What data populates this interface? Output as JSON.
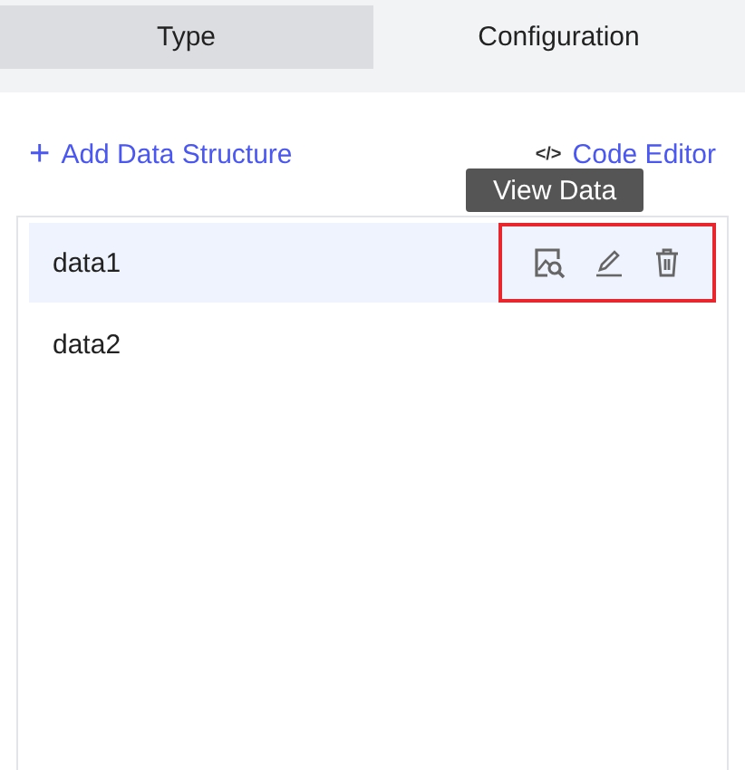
{
  "tabs": [
    {
      "label": "Type",
      "selected": true
    },
    {
      "label": "Configuration",
      "selected": false
    }
  ],
  "add_button": {
    "icon": "+",
    "label": "Add Data Structure"
  },
  "code_editor": {
    "icon": "</>",
    "label": "Code Editor"
  },
  "tooltip": {
    "text": "View Data"
  },
  "items": [
    {
      "name": "data1",
      "selected": true,
      "actions_shown": true
    },
    {
      "name": "data2",
      "selected": false,
      "actions_shown": false
    }
  ]
}
